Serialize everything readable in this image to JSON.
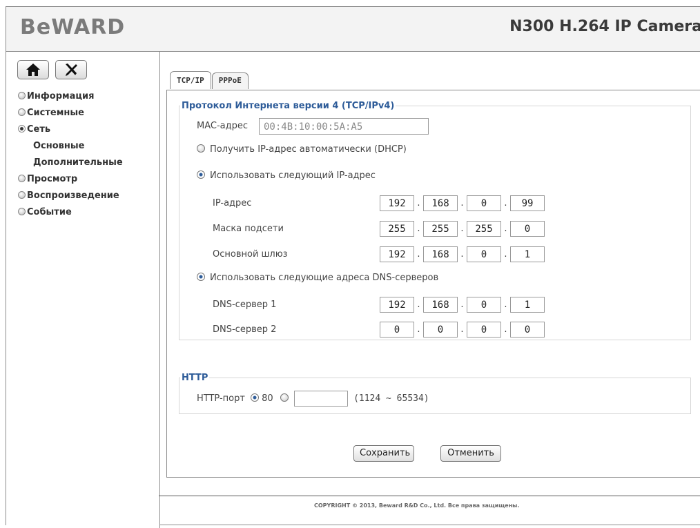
{
  "header": {
    "logo": "BeWARD",
    "title": "N300 H.264 IP Camera"
  },
  "sidebar": {
    "icons": [
      "home-icon",
      "tools-icon"
    ],
    "menu": [
      {
        "label": "Информация",
        "selected": false
      },
      {
        "label": "Системные",
        "selected": false
      },
      {
        "label": "Сеть",
        "selected": true
      },
      {
        "label": "Основные",
        "sub": true
      },
      {
        "label": "Дополнительные",
        "sub": true
      },
      {
        "label": "Просмотр",
        "selected": false
      },
      {
        "label": "Воспроизведение",
        "selected": false
      },
      {
        "label": "Событие",
        "selected": false
      }
    ]
  },
  "tabs": [
    {
      "label": "TCP/IP",
      "active": true
    },
    {
      "label": "PPPoE",
      "active": false
    }
  ],
  "ipv4": {
    "legend": "Протокол Интернета версии 4 (TCP/IPv4)",
    "mac_label": "MAC-адрес",
    "mac_value": "00:4B:10:00:5A:A5",
    "dhcp_label": "Получить IP-адрес автоматически (DHCP)",
    "dhcp_selected": false,
    "static_label": "Использовать следующий IP-адрес",
    "static_selected": true,
    "ip_label": "IP-адрес",
    "ip": [
      "192",
      "168",
      "0",
      "99"
    ],
    "mask_label": "Маска подсети",
    "mask": [
      "255",
      "255",
      "255",
      "0"
    ],
    "gateway_label": "Основной шлюз",
    "gateway": [
      "192",
      "168",
      "0",
      "1"
    ],
    "dns_mode_label": "Использовать следующие адреса DNS-серверов",
    "dns_mode_selected": true,
    "dns1_label": "DNS-сервер 1",
    "dns1": [
      "192",
      "168",
      "0",
      "1"
    ],
    "dns2_label": "DNS-сервер 2",
    "dns2": [
      "0",
      "0",
      "0",
      "0"
    ]
  },
  "http": {
    "legend": "HTTP",
    "port_label": "HTTP-порт",
    "default_port": "80",
    "default_selected": true,
    "custom_value": "",
    "range_hint": "(1124 ~ 65534)"
  },
  "buttons": {
    "save": "Сохранить",
    "cancel": "Отменить"
  },
  "footer": "COPYRIGHT © 2013, Beward R&D Co., Ltd. Все права защищены.",
  "colors": {
    "accent": "#2e5c99",
    "header_bg": "#f3f3f3",
    "border": "#8a8a8a"
  }
}
